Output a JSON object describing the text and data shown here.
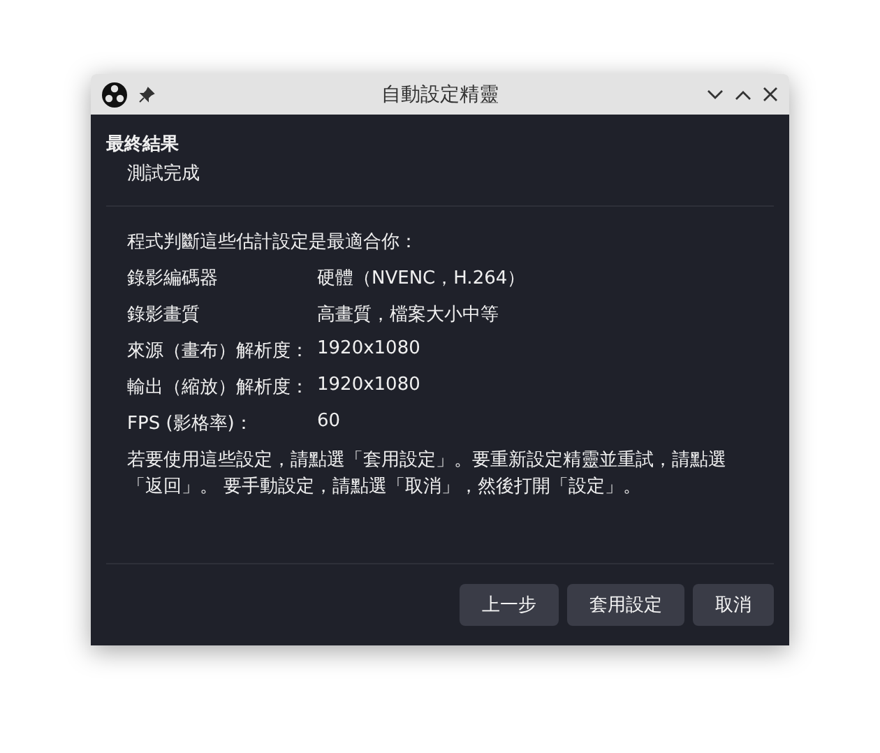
{
  "window": {
    "title": "自動設定精靈"
  },
  "header": {
    "title": "最終結果",
    "subtitle": "測試完成"
  },
  "intro": "程式判斷這些估計設定是最適合你：",
  "settings": [
    {
      "label": "錄影編碼器",
      "value": "硬體（NVENC，H.264）"
    },
    {
      "label": "錄影畫質",
      "value": "高畫質，檔案大小中等"
    },
    {
      "label": "來源（畫布）解析度：",
      "value": "1920x1080"
    },
    {
      "label": "輸出（縮放）解析度：",
      "value": "1920x1080"
    },
    {
      "label": "FPS (影格率)：",
      "value": "60"
    }
  ],
  "note": "若要使用這些設定，請點選「套用設定」。要重新設定精靈並重試，請點選「返回」。 要手動設定，請點選「取消」，然後打開「設定」。",
  "buttons": [
    "上一步",
    "套用設定",
    "取消"
  ]
}
